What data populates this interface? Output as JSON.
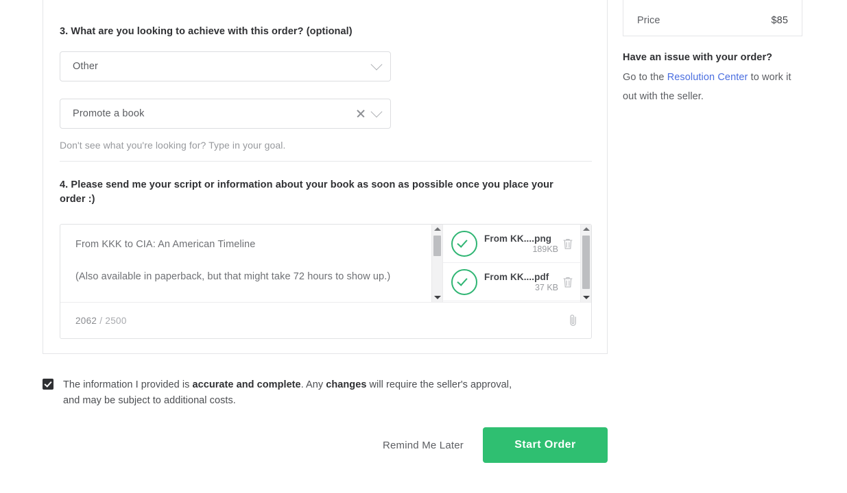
{
  "form": {
    "question3": {
      "label": "3. What are you looking to achieve with this order? (optional)",
      "select_primary": {
        "value": "Other",
        "chevron_icon": "chevron-down-icon"
      },
      "select_secondary": {
        "value": "Promote a book",
        "clear_icon": "close-x-icon",
        "chevron_icon": "chevron-down-icon"
      },
      "hint": "Don't see what you're looking for? Type in your goal."
    },
    "question4": {
      "label": "4. Please send me your script or information about your book as soon as possible once you place your order :)",
      "textarea_value": "From KKK to CIA: An American Timeline\n\n(Also available in paperback, but that might take 72 hours to show up.)",
      "counter_current": "2062",
      "counter_separator": "/",
      "counter_max": "2500",
      "attach_icon": "paperclip-icon",
      "files": [
        {
          "name": "From KK....png",
          "size": "189KB",
          "status_icon": "check-circle-icon",
          "delete_icon": "trash-icon"
        },
        {
          "name": "From KK....pdf",
          "size": "37 KB",
          "status_icon": "check-circle-icon",
          "delete_icon": "trash-icon"
        }
      ]
    }
  },
  "confirmation": {
    "checkbox_checked": true,
    "text_part1": "The information I provided is ",
    "text_bold1": "accurate and complete",
    "text_part2": ". Any ",
    "text_bold2": "changes",
    "text_part3": " will require the seller's approval, and may be subject to additional costs."
  },
  "actions": {
    "remind_label": "Remind Me Later",
    "start_label": "Start Order"
  },
  "sidebar": {
    "price_label": "Price",
    "price_value": "$85",
    "issue_title": "Have an issue with your order?",
    "issue_prefix": "Go to the ",
    "issue_link": "Resolution Center",
    "issue_suffix": " to work it out with the seller."
  },
  "colors": {
    "accent_green": "#2fbf71",
    "status_green": "#2fb573",
    "link_blue": "#4a6ee0"
  }
}
